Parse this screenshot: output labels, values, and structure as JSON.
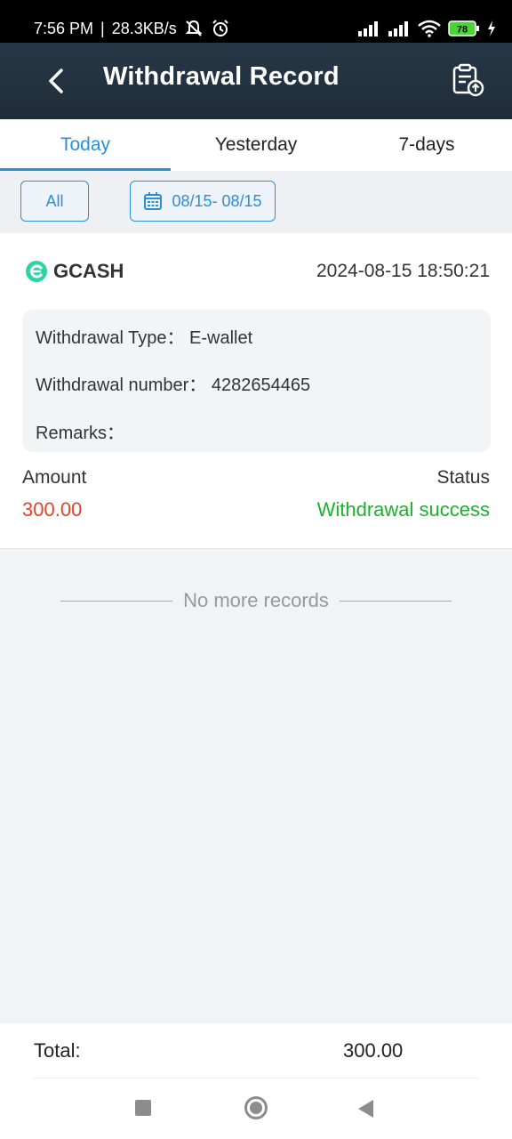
{
  "status_bar": {
    "time": "7:56 PM",
    "speed": "28.3KB/s",
    "battery": "78"
  },
  "header": {
    "title": "Withdrawal Record",
    "back_icon": "chevron-left-icon",
    "upload_icon": "clipboard-upload-icon"
  },
  "tabs": [
    {
      "label": "Today",
      "active": true
    },
    {
      "label": "Yesterday",
      "active": false
    },
    {
      "label": "7-days",
      "active": false
    }
  ],
  "filters": {
    "all_label": "All",
    "date_range": "08/15- 08/15"
  },
  "record": {
    "provider": "GCASH",
    "datetime": "2024-08-15 18:50:21",
    "type_label": "Withdrawal Type：",
    "type_value": "E-wallet",
    "number_label": "Withdrawal number：",
    "number_value": "4282654465",
    "remarks_label": "Remarks：",
    "remarks_value": "",
    "amount_label": "Amount",
    "amount_value": "300.00",
    "status_label": "Status",
    "status_value": "Withdrawal success"
  },
  "no_more_text": "No more records",
  "total": {
    "label": "Total:",
    "value": "300.00"
  },
  "colors": {
    "accent": "#2a8fd4",
    "amount": "#e0452b",
    "success": "#1ab22b",
    "header_bg": "#223240"
  }
}
